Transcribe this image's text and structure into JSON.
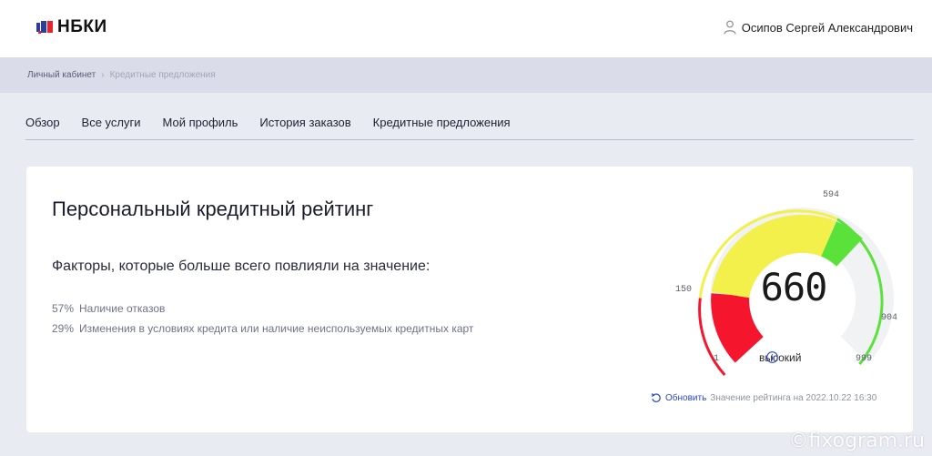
{
  "header": {
    "logo_text": "НБКИ",
    "user_name": "Осипов Сергей Александрович"
  },
  "breadcrumb": {
    "items": [
      "Личный кабинет",
      "Кредитные предложения"
    ],
    "separator": "›"
  },
  "nav": {
    "tabs": [
      {
        "label": "Обзор"
      },
      {
        "label": "Все услуги"
      },
      {
        "label": "Мой профиль"
      },
      {
        "label": "История заказов"
      },
      {
        "label": "Кредитные предложения"
      }
    ]
  },
  "rating": {
    "title": "Персональный кредитный рейтинг",
    "factors_heading": "Факторы, которые больше всего повлияли на значение:",
    "factors": [
      {
        "pct": "57%",
        "text": "Наличие отказов"
      },
      {
        "pct": "29%",
        "text": "Изменения в условиях кредита или наличие неиспользуемых кредитных карт"
      }
    ]
  },
  "gauge": {
    "score": "660",
    "level_label": "высокий",
    "ticks": {
      "t1": "1",
      "t150": "150",
      "t594": "594",
      "t904": "904",
      "t999": "999"
    },
    "colors": {
      "red": "#f5162e",
      "yellow": "#f4f04b",
      "green": "#5be23a",
      "track": "#f1f2f4"
    }
  },
  "refresh": {
    "label": "Обновить",
    "meta": "Значение рейтинга на 2022.10.22 16:30"
  },
  "watermark": "©fixogram.ru"
}
